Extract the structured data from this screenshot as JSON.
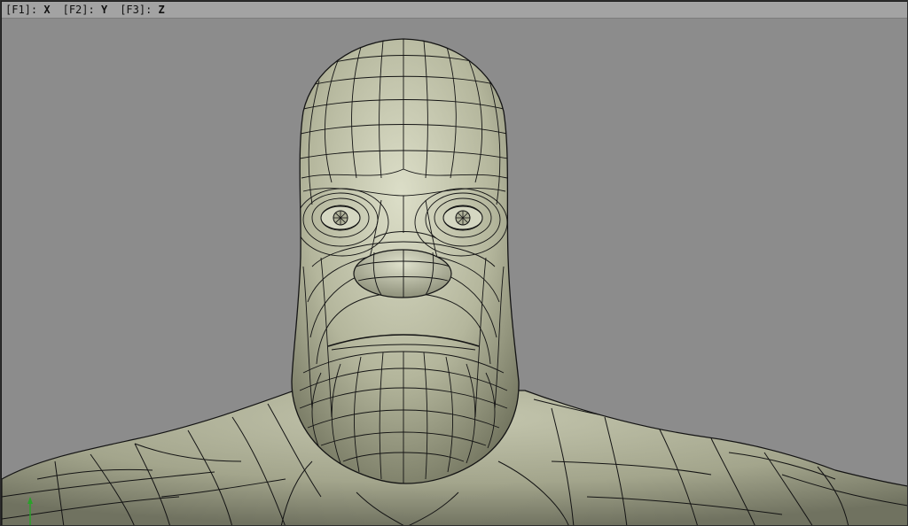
{
  "viewport": {
    "axis_keys": [
      {
        "key": "[F1]:",
        "axis": "X"
      },
      {
        "key": "[F2]:",
        "axis": "Y"
      },
      {
        "key": "[F3]:",
        "axis": "Z"
      }
    ],
    "background_color": "#8c8c8c",
    "mesh_color": "#c2c4ac",
    "wire_color": "#141414"
  },
  "axis_gizmo": {
    "x_color": "#d22020",
    "y_color": "#2aa02a"
  }
}
